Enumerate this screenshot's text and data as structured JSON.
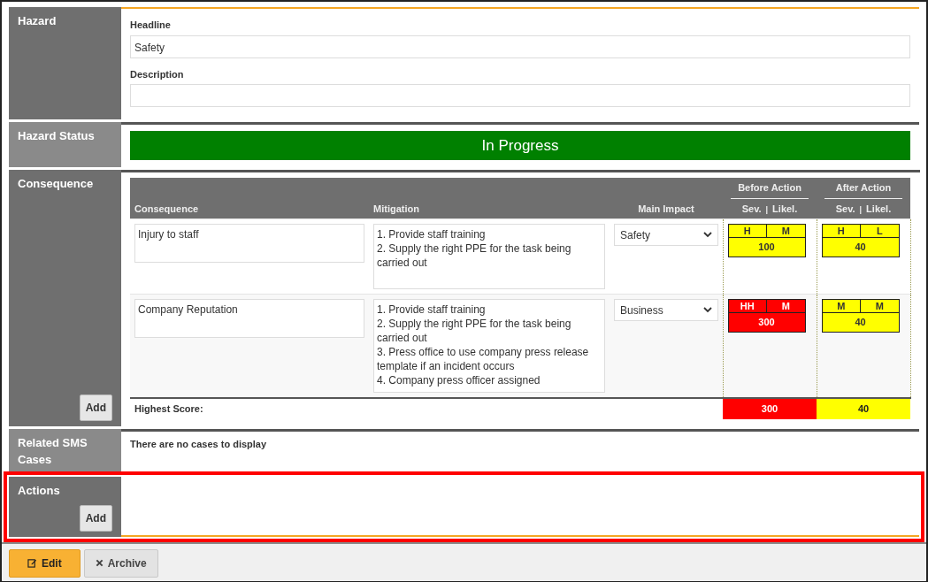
{
  "hazard": {
    "label": "Hazard",
    "fields": [
      {
        "label": "Headline",
        "value": "Safety"
      },
      {
        "label": "Description"
      }
    ]
  },
  "status": {
    "label": "Hazard Status",
    "value": "In Progress",
    "color": "#008000"
  },
  "consequence": {
    "label": "Consequence",
    "add_button": "Add",
    "columns": [
      "Consequence",
      "Mitigation",
      "Main Impact"
    ],
    "groups": [
      {
        "title": "Before Action",
        "sev": "Sev.",
        "sep": "|",
        "likel": "Likel."
      },
      {
        "title": "After Action",
        "sev": "Sev.",
        "sep": "|",
        "likel": "Likel."
      }
    ],
    "rows": [
      {
        "consequence": "Injury to staff",
        "mitigation": "1. Provide staff training\n2. Supply the right PPE for the task being carried out",
        "impact": "Safety",
        "ratings": [
          {
            "sev": "H",
            "likel": "M",
            "score": "100",
            "color": "#ffff00"
          },
          {
            "sev": "H",
            "likel": "L",
            "score": "40",
            "color": "#ffff00"
          }
        ]
      },
      {
        "consequence": "Company Reputation",
        "mitigation": "1. Provide staff training\n2. Supply the right PPE for the task being carried out\n3. Press office to use company press release template if an incident occurs\n4. Company press officer assigned",
        "impact": "Business",
        "ratings": [
          {
            "sev": "HH",
            "likel": "M",
            "score": "300",
            "color": "#ff0000"
          },
          {
            "sev": "M",
            "likel": "M",
            "score": "40",
            "color": "#ffff00"
          }
        ]
      }
    ],
    "highest": {
      "label": "Highest Score:",
      "scores": [
        {
          "score": "300",
          "color": "#ff0000"
        },
        {
          "score": "40",
          "color": "#ffff00"
        }
      ]
    }
  },
  "related": {
    "label": "Related SMS Cases",
    "text": "There are no cases to display"
  },
  "actions": {
    "label": "Actions",
    "add_button": "Add",
    "highlighted": true
  },
  "footer": {
    "buttons": [
      {
        "label": "Edit",
        "kind": "primary"
      },
      {
        "label": "Archive",
        "kind": "secondary"
      }
    ]
  }
}
